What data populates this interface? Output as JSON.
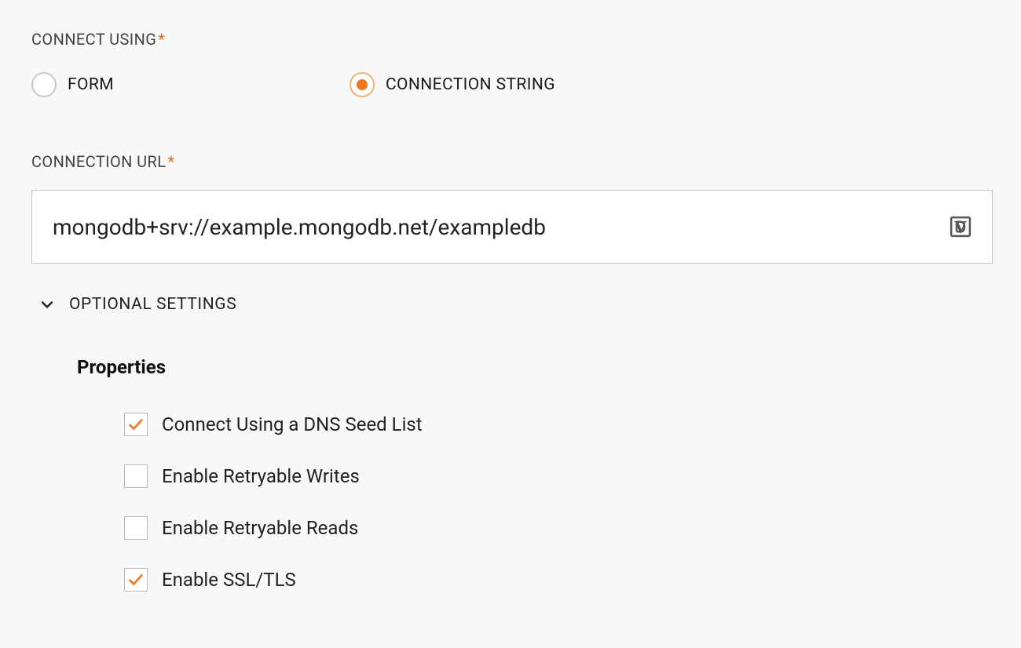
{
  "connectUsing": {
    "label": "CONNECT USING",
    "required": "*",
    "options": [
      {
        "label": "FORM",
        "selected": false
      },
      {
        "label": "CONNECTION STRING",
        "selected": true
      }
    ]
  },
  "connectionUrl": {
    "label": "CONNECTION URL",
    "required": "*",
    "value": "mongodb+srv://example.mongodb.net/exampledb"
  },
  "optional": {
    "label": "OPTIONAL SETTINGS",
    "propertiesHeading": "Properties",
    "items": [
      {
        "label": "Connect Using a DNS Seed List",
        "checked": true
      },
      {
        "label": "Enable Retryable Writes",
        "checked": false
      },
      {
        "label": "Enable Retryable Reads",
        "checked": false
      },
      {
        "label": "Enable SSL/TLS",
        "checked": true
      }
    ]
  }
}
